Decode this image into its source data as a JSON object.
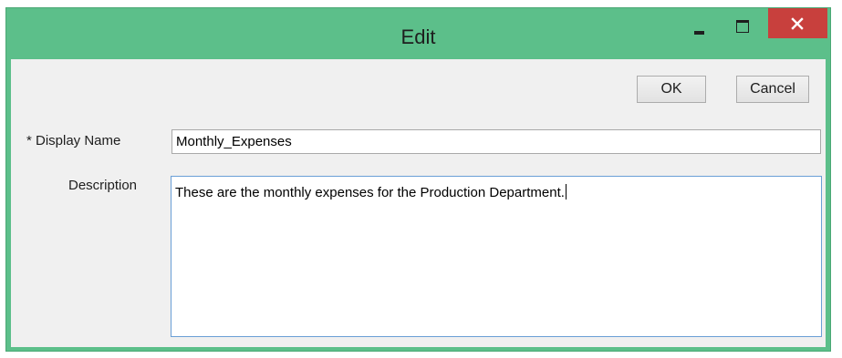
{
  "window": {
    "title": "Edit",
    "controls": {
      "minimize": "minimize-icon",
      "maximize": "maximize-icon",
      "close": "close-icon"
    },
    "colors": {
      "frame": "#5cbf8a",
      "close": "#c8403d",
      "client": "#f0f0f0"
    }
  },
  "buttons": {
    "ok_label": "OK",
    "cancel_label": "Cancel"
  },
  "form": {
    "display_name": {
      "label": "* Display Name",
      "value": "Monthly_Expenses"
    },
    "description": {
      "label": "Description",
      "value": "These are the monthly expenses for the Production Department."
    }
  }
}
